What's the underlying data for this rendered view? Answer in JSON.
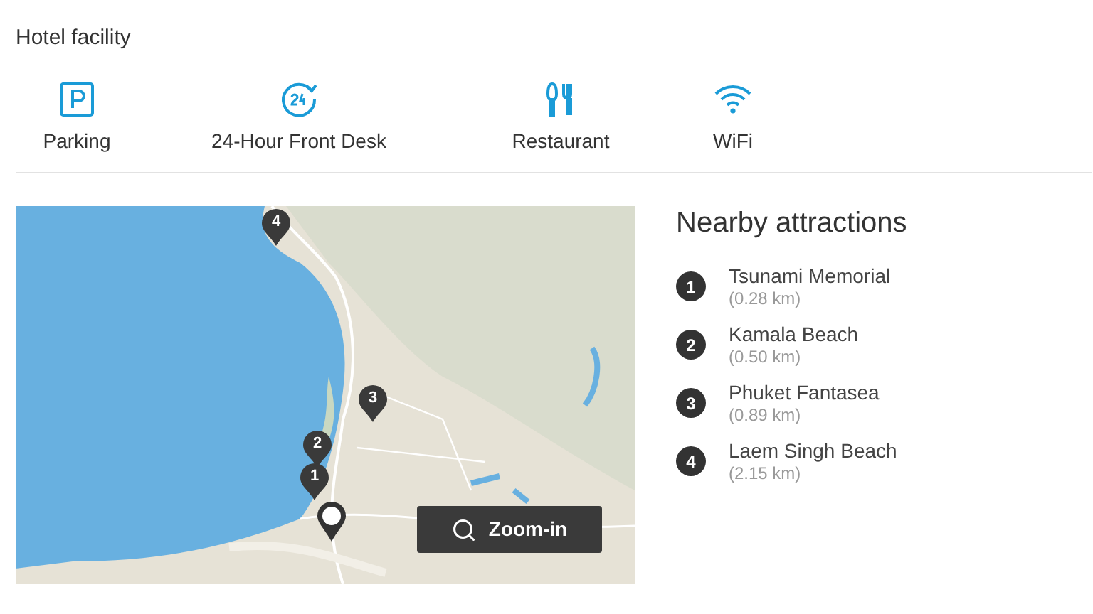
{
  "section_title": "Hotel facility",
  "facilities": [
    {
      "kind": "parking",
      "label": "Parking"
    },
    {
      "kind": "clock24",
      "label": "24-Hour Front Desk"
    },
    {
      "kind": "restaurant",
      "label": "Restaurant"
    },
    {
      "kind": "wifi",
      "label": "WiFi"
    }
  ],
  "map": {
    "pins": [
      {
        "kind": "attraction",
        "label": "4"
      },
      {
        "kind": "attraction",
        "label": "3"
      },
      {
        "kind": "attraction",
        "label": "2"
      },
      {
        "kind": "attraction",
        "label": "1"
      },
      {
        "kind": "hotel"
      }
    ],
    "zoom_button": "Zoom-in"
  },
  "nearby": {
    "title": "Nearby attractions",
    "items": [
      {
        "number": "1",
        "name": "Tsunami Memorial",
        "distance": "(0.28 km)"
      },
      {
        "number": "2",
        "name": "Kamala Beach",
        "distance": "(0.50 km)"
      },
      {
        "number": "3",
        "name": "Phuket Fantasea",
        "distance": "(0.89 km)"
      },
      {
        "number": "4",
        "name": "Laem Singh Beach",
        "distance": "(2.15 km)"
      }
    ]
  }
}
